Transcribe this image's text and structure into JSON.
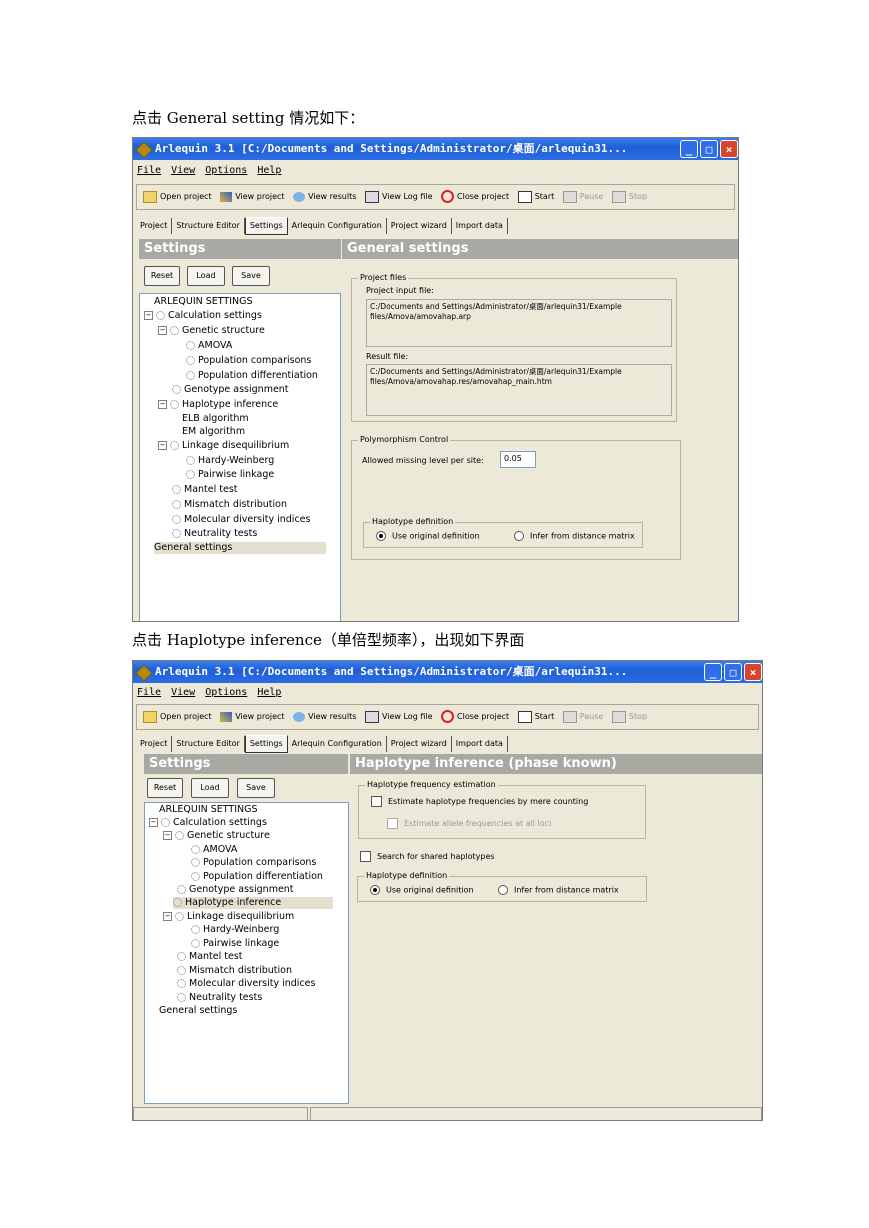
{
  "paragraph1": "点击 General setting 情况如下：",
  "paragraph2": "点击 Haplotype inference（单倍型频率），出现如下界面",
  "window_title": "Arlequin 3.1 [C:/Documents and Settings/Administrator/桌面/arlequin31...",
  "menu": [
    "File",
    "View",
    "Options",
    "Help"
  ],
  "toolbar": {
    "open": "Open project",
    "view_project": "View project",
    "view_results": "View results",
    "view_log": "View Log file",
    "close": "Close project",
    "start": "Start",
    "pause": "Pause",
    "stop": "Stop"
  },
  "tabs": [
    "Project",
    "Structure Editor",
    "Settings",
    "Arlequin Configuration",
    "Project wizard",
    "Import data"
  ],
  "settings_header": "Settings",
  "buttons": {
    "reset": "Reset",
    "load": "Load",
    "save": "Save"
  },
  "tree": {
    "root": "ARLEQUIN SETTINGS",
    "calc": "Calculation settings",
    "genetic": "Genetic structure",
    "amova": "AMOVA",
    "pop_comp": "Population comparisons",
    "pop_diff": "Population differentiation",
    "genotype": "Genotype assignment",
    "haplotype": "Haplotype inference",
    "elb": "ELB algorithm",
    "em": "EM algorithm",
    "linkage": "Linkage disequilibrium",
    "hardy": "Hardy-Weinberg",
    "pairwise": "Pairwise linkage",
    "mantel": "Mantel test",
    "mismatch": "Mismatch distribution",
    "molecular": "Molecular diversity indices",
    "neutrality": "Neutrality tests",
    "general": "General settings"
  },
  "general": {
    "header": "General settings",
    "project_files": "Project files",
    "input_label": "Project input file:",
    "input_value": "C:/Documents and Settings/Administrator/桌面/arlequin31/Example files/Amova/amovahap.arp",
    "result_label": "Result file:",
    "result_value": "C:/Documents and Settings/Administrator/桌面/arlequin31/Example files/Amova/amovahap.res/amovahap_main.htm",
    "poly": "Polymorphism Control",
    "missing_label": "Allowed missing level per site:",
    "missing_value": "0.05",
    "hapdef": "Haplotype definition",
    "opt_original": "Use original definition",
    "opt_infer": "Infer from distance matrix"
  },
  "haplo": {
    "header": "Haplotype inference (phase known)",
    "freq_group": "Haplotype frequency estimation",
    "estimate_hap": "Estimate haplotype frequencies by mere counting",
    "estimate_allele": "Estimate allele frequencies at all loci",
    "search_shared": "Search for shared haplotypes",
    "hapdef": "Haplotype definition",
    "opt_original": "Use original definition",
    "opt_infer": "Infer from distance matrix"
  },
  "colors": {
    "titlebar": "#1f5fd6",
    "header_gray": "#a9a9a3",
    "window_bg": "#ece9d8"
  }
}
